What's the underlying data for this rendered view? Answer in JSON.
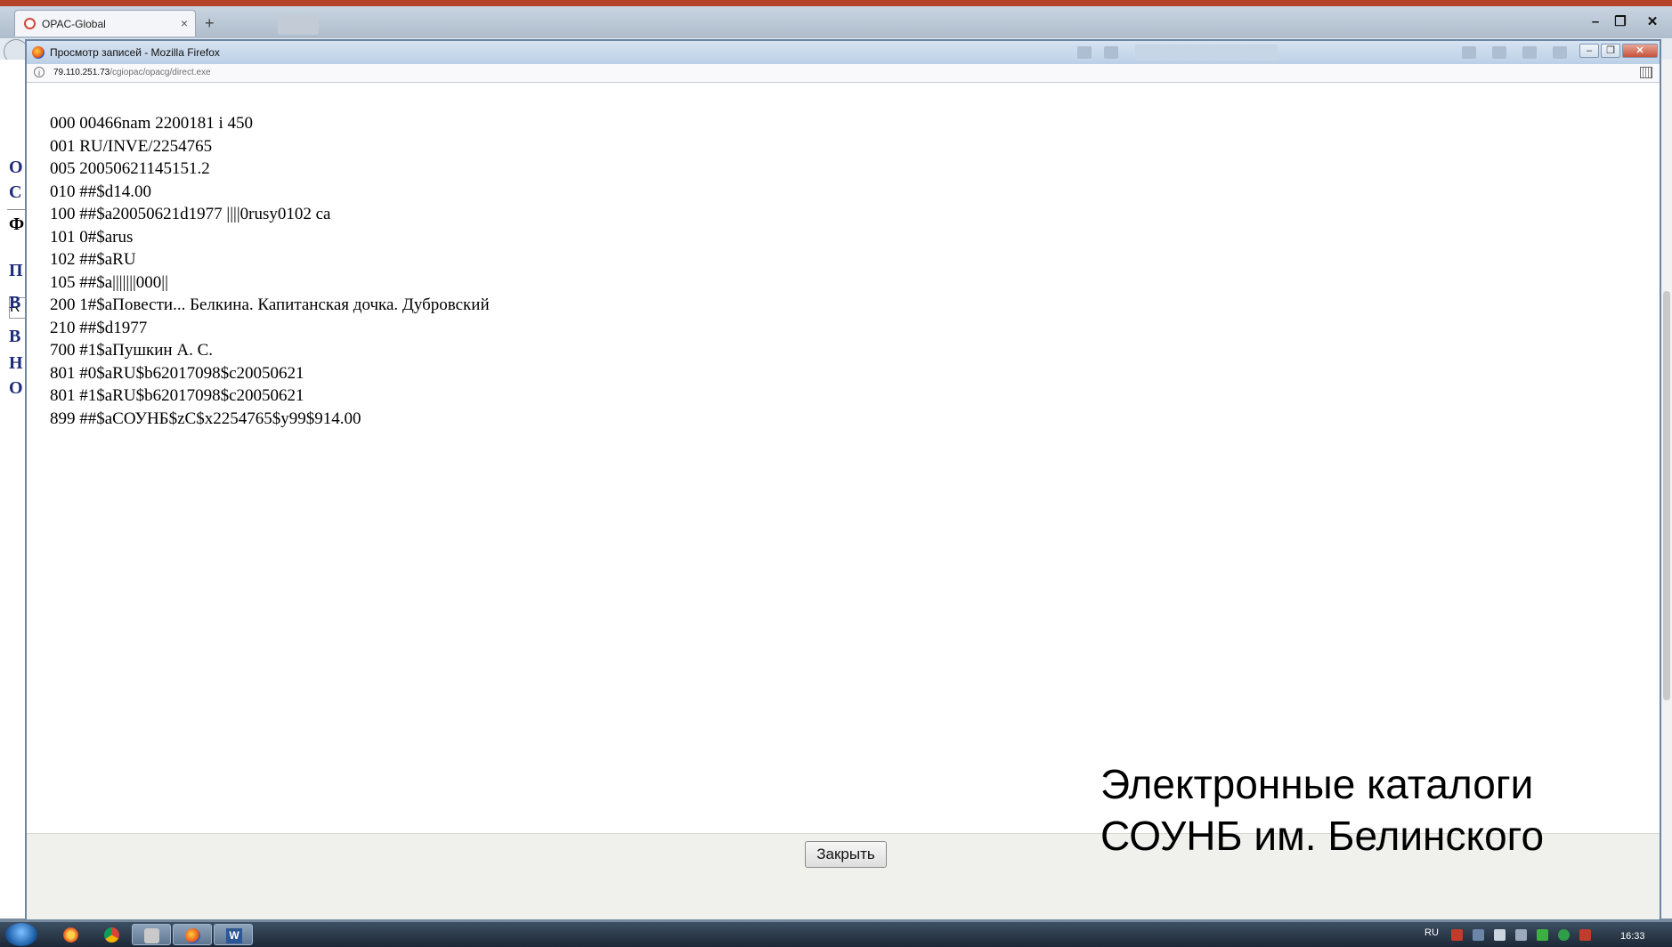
{
  "outer_browser": {
    "tab_title": "OPAC-Global",
    "new_tab_label": "+",
    "tab_close": "×",
    "window_controls": {
      "minimize": "–",
      "restore": "❐",
      "close": "✕"
    }
  },
  "background_page": {
    "fragments": [
      "О",
      "С",
      "Ф",
      "R",
      "П",
      "В",
      "В",
      "Н",
      "О"
    ]
  },
  "popup": {
    "title": "Просмотр записей - Mozilla Firefox",
    "url_host": "79.110.251.73",
    "url_path": "/cgiopac/opacg/direct.exe",
    "record_lines": [
      "000 00466nam 2200181 i 450",
      "001 RU/INVE/2254765",
      "005 20050621145151.2",
      "010 ##$d14.00",
      "100 ##$a20050621d1977 ||||0rusy0102 ca",
      "101 0#$arus",
      "102 ##$aRU",
      "105 ##$a|||||||000||",
      "200 1#$aПовести... Белкина. Капитанская дочка. Дубровский",
      "210 ##$d1977",
      "700 #1$aПушкин А. С.",
      "801 #0$aRU$b62017098$c20050621",
      "801 #1$aRU$b62017098$c20050621",
      "899 ##$aСОУНБ$zC$x2254765$y99$914.00"
    ],
    "close_button_label": "Закрыть"
  },
  "caption": {
    "line1": "Электронные каталоги",
    "line2": "СОУНБ им. Белинского"
  },
  "taskbar": {
    "language": "RU",
    "clock": "16:33",
    "word_letter": "W",
    "apps": [
      "start-orb-icon",
      "chrome-icon",
      "chrome-icon",
      "app-icon",
      "firefox-icon",
      "word-icon"
    ]
  },
  "colors": {
    "link_blue": "#1c2b7a",
    "taskbar": "#1c2836",
    "popup_border": "#6c86a3"
  }
}
